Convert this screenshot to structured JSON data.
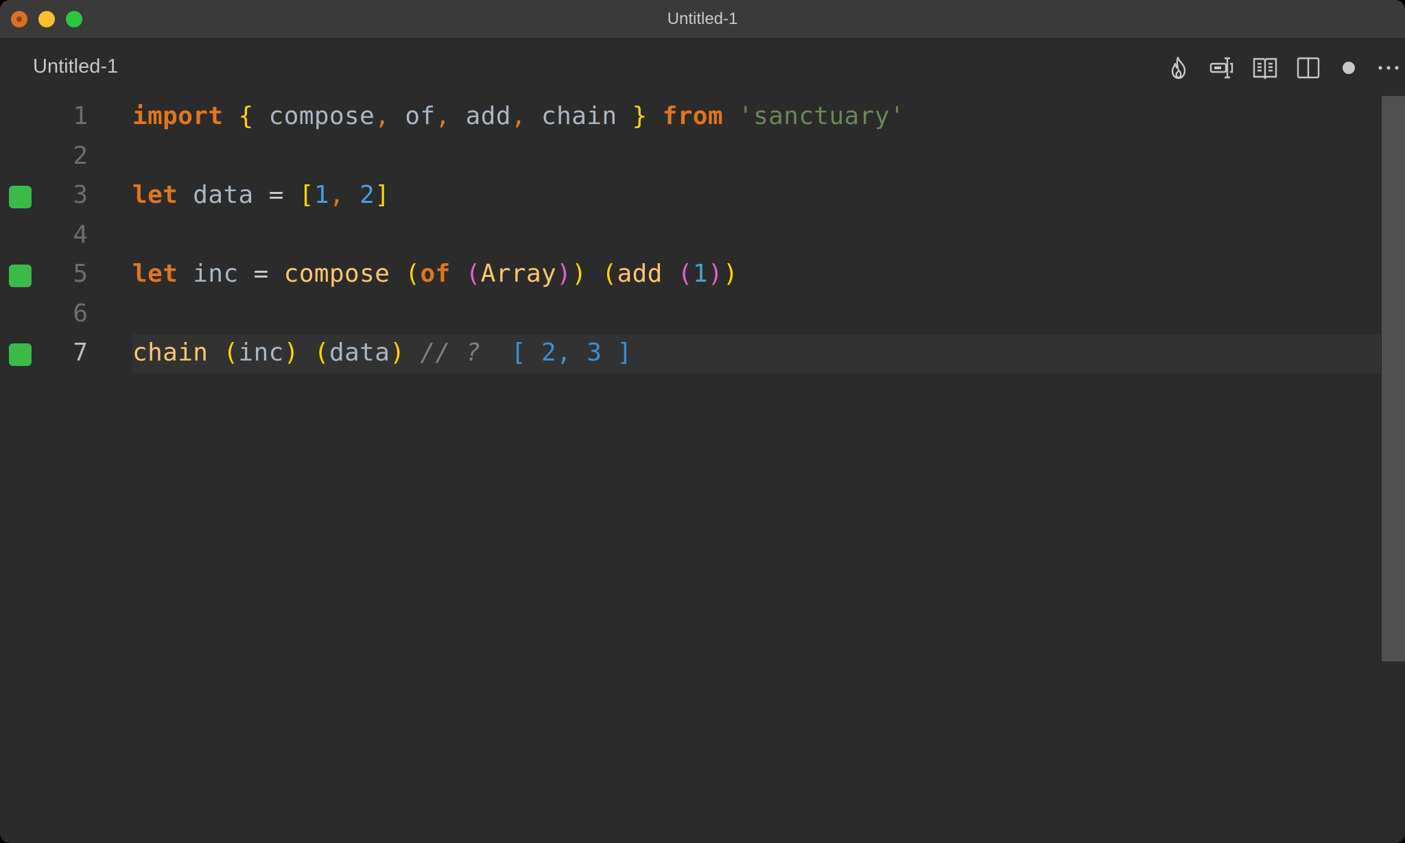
{
  "window": {
    "title": "Untitled-1",
    "traffic_lights": [
      "close",
      "minimize",
      "maximize"
    ]
  },
  "tab": {
    "label": "Untitled-1"
  },
  "toolbar": {
    "actions": [
      {
        "name": "flame-icon",
        "title": "Toggle Quokka"
      },
      {
        "name": "value-explorer-icon",
        "title": "Show Value"
      },
      {
        "name": "open-preview-icon",
        "title": "Open Preview"
      },
      {
        "name": "split-editor-icon",
        "title": "Split Editor"
      },
      {
        "name": "unsaved-dot-icon",
        "title": "Unsaved"
      },
      {
        "name": "more-actions-icon",
        "title": "More Actions"
      }
    ]
  },
  "editor": {
    "current_line": 7,
    "lines": [
      {
        "n": "1",
        "marker": false,
        "tokens": [
          {
            "t": "import",
            "c": "kw"
          },
          {
            "t": " ",
            "c": "id"
          },
          {
            "t": "{",
            "c": "br1"
          },
          {
            "t": " compose",
            "c": "id"
          },
          {
            "t": ",",
            "c": "punc"
          },
          {
            "t": " of",
            "c": "id"
          },
          {
            "t": ",",
            "c": "punc"
          },
          {
            "t": " add",
            "c": "id"
          },
          {
            "t": ",",
            "c": "punc"
          },
          {
            "t": " chain ",
            "c": "id"
          },
          {
            "t": "}",
            "c": "br1"
          },
          {
            "t": " ",
            "c": "id"
          },
          {
            "t": "from",
            "c": "kw"
          },
          {
            "t": " ",
            "c": "id"
          },
          {
            "t": "'sanctuary'",
            "c": "str"
          }
        ]
      },
      {
        "n": "2",
        "marker": false,
        "tokens": []
      },
      {
        "n": "3",
        "marker": true,
        "tokens": [
          {
            "t": "let",
            "c": "kw"
          },
          {
            "t": " data ",
            "c": "id"
          },
          {
            "t": "=",
            "c": "op"
          },
          {
            "t": " ",
            "c": "id"
          },
          {
            "t": "[",
            "c": "br1"
          },
          {
            "t": "1",
            "c": "num"
          },
          {
            "t": ",",
            "c": "punc"
          },
          {
            "t": " ",
            "c": "id"
          },
          {
            "t": "2",
            "c": "num"
          },
          {
            "t": "]",
            "c": "br1"
          }
        ]
      },
      {
        "n": "4",
        "marker": false,
        "tokens": []
      },
      {
        "n": "5",
        "marker": true,
        "tokens": [
          {
            "t": "let",
            "c": "kw"
          },
          {
            "t": " inc ",
            "c": "id"
          },
          {
            "t": "=",
            "c": "op"
          },
          {
            "t": " ",
            "c": "id"
          },
          {
            "t": "compose",
            "c": "fn"
          },
          {
            "t": " ",
            "c": "id"
          },
          {
            "t": "(",
            "c": "br1"
          },
          {
            "t": "of",
            "c": "kw"
          },
          {
            "t": " ",
            "c": "id"
          },
          {
            "t": "(",
            "c": "br2"
          },
          {
            "t": "Array",
            "c": "fn"
          },
          {
            "t": ")",
            "c": "br2"
          },
          {
            "t": ")",
            "c": "br1"
          },
          {
            "t": " ",
            "c": "id"
          },
          {
            "t": "(",
            "c": "br1"
          },
          {
            "t": "add",
            "c": "fn"
          },
          {
            "t": " ",
            "c": "id"
          },
          {
            "t": "(",
            "c": "br2"
          },
          {
            "t": "1",
            "c": "num"
          },
          {
            "t": ")",
            "c": "br2"
          },
          {
            "t": ")",
            "c": "br1"
          }
        ]
      },
      {
        "n": "6",
        "marker": false,
        "tokens": []
      },
      {
        "n": "7",
        "marker": true,
        "tokens": [
          {
            "t": "chain",
            "c": "fn"
          },
          {
            "t": " ",
            "c": "id"
          },
          {
            "t": "(",
            "c": "br1"
          },
          {
            "t": "inc",
            "c": "id"
          },
          {
            "t": ")",
            "c": "br1"
          },
          {
            "t": " ",
            "c": "id"
          },
          {
            "t": "(",
            "c": "br1"
          },
          {
            "t": "data",
            "c": "id"
          },
          {
            "t": ")",
            "c": "br1"
          },
          {
            "t": " ",
            "c": "id"
          },
          {
            "t": "// ?",
            "c": "cmt"
          },
          {
            "t": "  ",
            "c": "id"
          },
          {
            "t": "[ 2, 3 ]",
            "c": "res"
          }
        ]
      }
    ]
  },
  "colors": {
    "marker": "#3cba48",
    "keyword": "#e0761d",
    "string": "#6a8759",
    "number": "#4a9fd9",
    "result": "#3d8fd1"
  }
}
